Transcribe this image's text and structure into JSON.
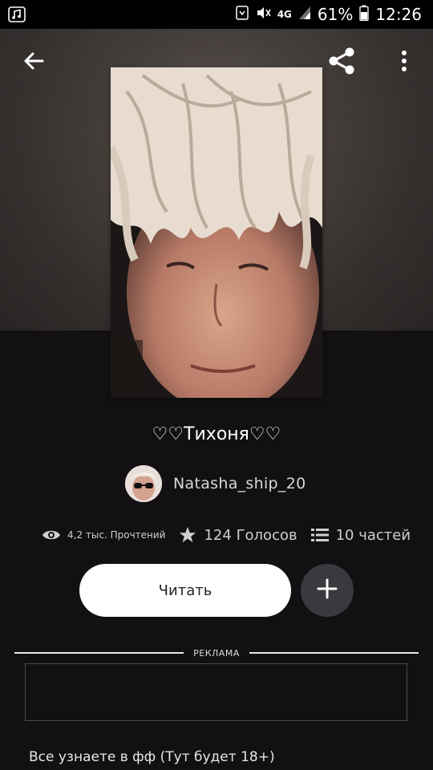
{
  "status_bar": {
    "left_icon": "music-note-icon",
    "battery_percent": "61%",
    "network": "4G",
    "time": "12:26"
  },
  "appbar": {
    "back_icon": "arrow-left-icon",
    "share_icon": "share-icon",
    "more_icon": "more-vertical-icon"
  },
  "story": {
    "title": "♡♡Тихоня♡♡",
    "author": "Natasha_ship_20",
    "reads": "4,2 тыс. Прочтений",
    "votes": "124 Голосов",
    "parts": "10 частей",
    "description": "Все узнаете в фф (Тут будет 18+)"
  },
  "actions": {
    "read_label": "Читать",
    "add_icon": "plus-icon"
  },
  "ad": {
    "label": "РЕКЛАМА"
  }
}
